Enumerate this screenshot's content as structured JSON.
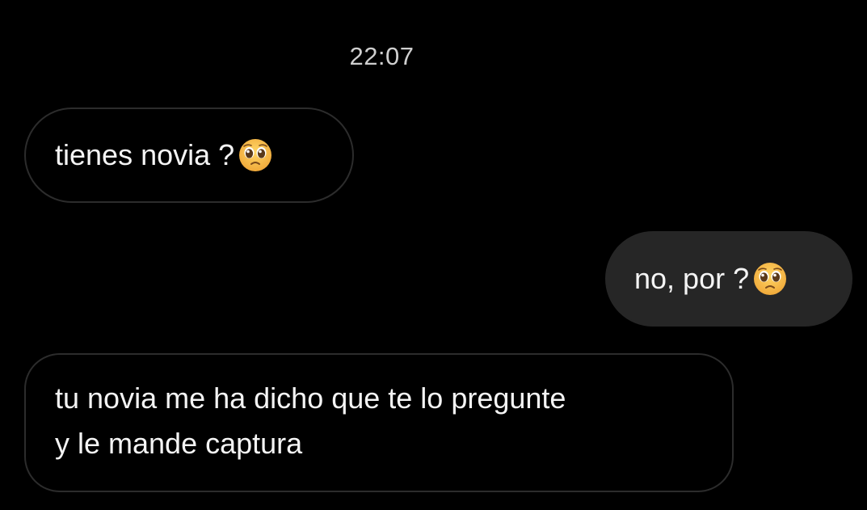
{
  "chat": {
    "timestamp": "22:07",
    "messages": [
      {
        "sender": "other",
        "text": "tienes novia ?",
        "emoji": "pleading-face-icon"
      },
      {
        "sender": "me",
        "text": "no, por ?",
        "emoji": "pleading-face-icon"
      },
      {
        "sender": "other",
        "text": "tu novia me ha dicho que te lo pregunte\ny le mande captura"
      }
    ]
  },
  "colors": {
    "background": "#000000",
    "sent_bubble": "#262626",
    "received_bubble_border": "#2c2c2c",
    "text": "#f4f4f4",
    "emoji_face": "#f5c242"
  }
}
